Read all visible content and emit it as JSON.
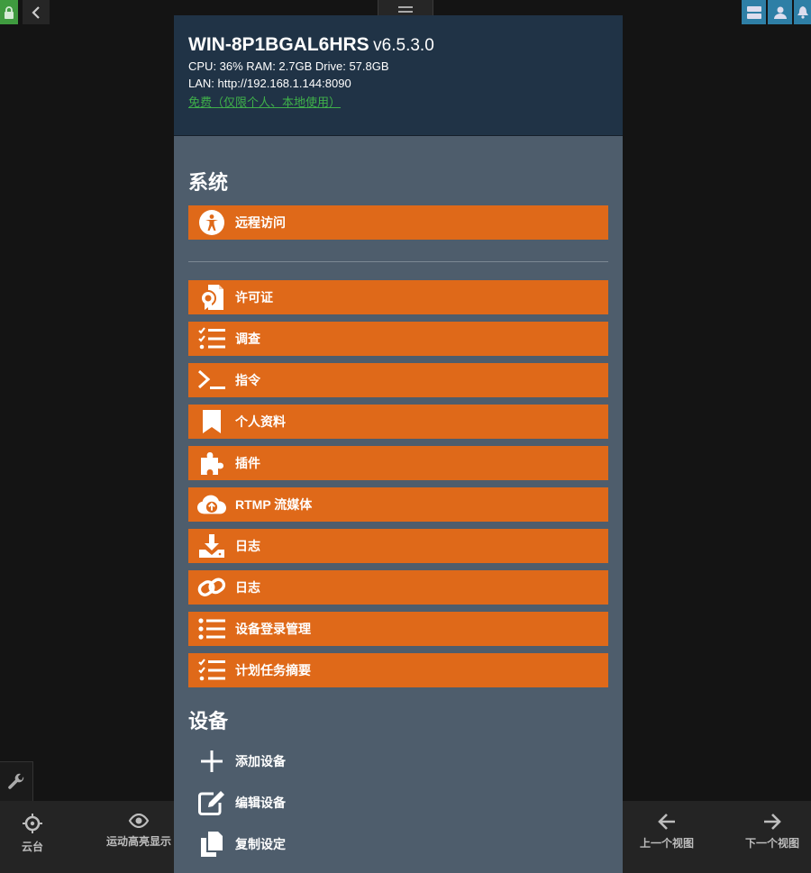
{
  "server": {
    "hostname": "WIN-8P1BGAL6HRS",
    "version": "v6.5.3.0",
    "stats": "CPU: 36% RAM: 2.7GB Drive: 57.8GB",
    "lan": "LAN: http://192.168.1.144:8090",
    "license_link": "免费（仅限个人、本地使用）"
  },
  "sections": {
    "system": "系统",
    "devices": "设备"
  },
  "system_buttons": [
    {
      "label": "远程访问",
      "icon": "accessibility-icon"
    },
    {
      "label": "许可证",
      "icon": "certificate-icon"
    },
    {
      "label": "调查",
      "icon": "checklist-icon"
    },
    {
      "label": "指令",
      "icon": "terminal-icon"
    },
    {
      "label": "个人资料",
      "icon": "bookmark-icon"
    },
    {
      "label": "插件",
      "icon": "puzzle-icon"
    },
    {
      "label": "RTMP 流媒体",
      "icon": "cloud-upload-icon"
    },
    {
      "label": "日志",
      "icon": "download-icon"
    },
    {
      "label": "日志",
      "icon": "link-icon"
    },
    {
      "label": "设备登录管理",
      "icon": "list-icon"
    },
    {
      "label": "计划任务摘要",
      "icon": "checklist-icon"
    }
  ],
  "device_items": [
    {
      "label": "添加设备",
      "icon": "plus-icon"
    },
    {
      "label": "编辑设备",
      "icon": "edit-icon"
    },
    {
      "label": "复制设定",
      "icon": "copy-icon"
    }
  ],
  "bottom_bar": {
    "ptz": "云台",
    "motion": "运动高亮显示",
    "prev_view": "上一个视图",
    "next_view": "下一个视图"
  },
  "colors": {
    "accent": "#df6919",
    "header": "#203346",
    "modal_bg": "#4e5d6c",
    "link_green": "#3fb04a"
  }
}
